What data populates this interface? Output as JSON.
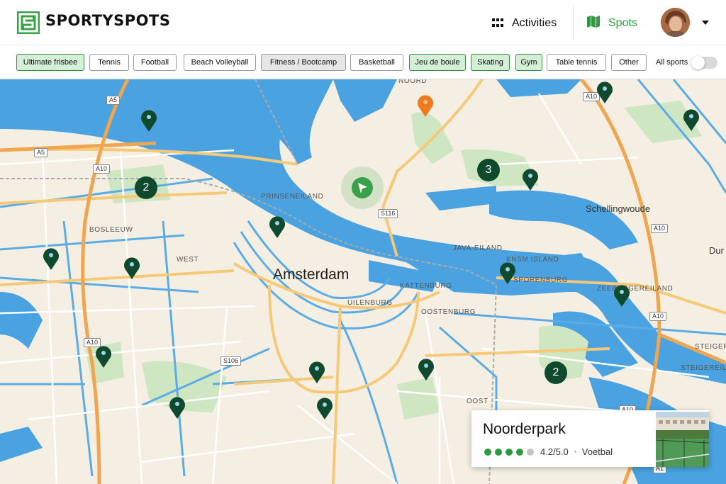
{
  "header": {
    "brand": "SPORTYSPOTS",
    "nav": {
      "activities": "Activities",
      "spots": "Spots"
    },
    "accent_color": "#2e9a3f",
    "icons": [
      "logo-s-icon",
      "grid-icon",
      "map-icon",
      "caret-down-icon"
    ]
  },
  "filters": {
    "chips": [
      {
        "label": "Ultimate frisbee",
        "state": "on"
      },
      {
        "label": "Tennis",
        "state": "off"
      },
      {
        "label": "Football",
        "state": "off"
      },
      {
        "label": "Beach Volleyball",
        "state": "off"
      },
      {
        "label": "Fitness / Bootcamp",
        "state": "grey"
      },
      {
        "label": "Basketball",
        "state": "off"
      },
      {
        "label": "Jeu de boule",
        "state": "on"
      },
      {
        "label": "Skating",
        "state": "on"
      },
      {
        "label": "Gym",
        "state": "on"
      },
      {
        "label": "Table tennis",
        "state": "off"
      },
      {
        "label": "Other",
        "state": "off"
      }
    ],
    "all_sports_label": "All sports",
    "all_sports_on": false
  },
  "map": {
    "city": "Amsterdam",
    "places": {
      "noord": "NOORD",
      "prinseneiland": "PRINSENEILAND",
      "bosleeuw": "BOSLEEUW",
      "west": "WEST",
      "java": "JAVA-EILAND",
      "knsm": "KNSM ISLAND",
      "sporenburg": "SPORENBURG",
      "kattenburg": "KATTENBURG",
      "uilenburg": "UILENBURG",
      "oostenburg": "OOSTENBURG",
      "zeeburgereiland": "ZEEBURGEREILAND",
      "steigereiland": "STEIGEREILAND",
      "steigere": "STEIGERE",
      "oost": "OOST",
      "schellingwoude": "Schellingwoude",
      "dur": "Dur"
    },
    "roads": {
      "a5_1": "A5",
      "a5_2": "A5",
      "a10_1": "A10",
      "a10_2": "A10",
      "a10_3": "A10",
      "a10_4": "A10",
      "a10_5": "A10",
      "a10_6": "A10",
      "s116": "S116",
      "s106": "S106",
      "a1": "A1"
    },
    "clusters": [
      "2",
      "3",
      "2"
    ],
    "pin_color": "#0f4a2f",
    "selected_pin_color": "#ee7a1e"
  },
  "card": {
    "title": "Noorderpark",
    "rating": "4.2/5.0",
    "rating_value": 4.2,
    "rating_max": 5,
    "category": "Voetbal"
  }
}
